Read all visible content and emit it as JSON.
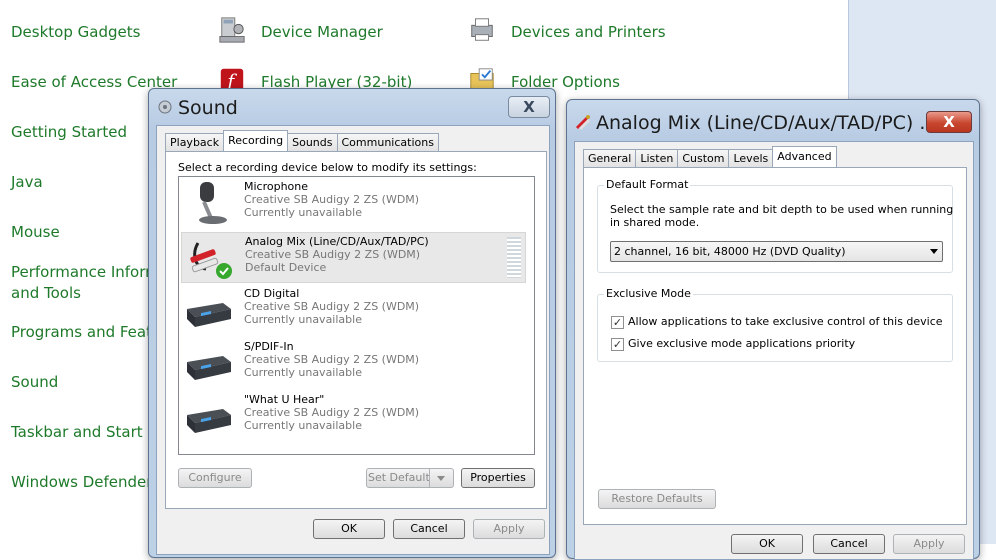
{
  "control_panel": {
    "left_links": [
      "Desktop Gadgets",
      "Ease of Access Center",
      "Getting Started",
      "Java",
      "Mouse",
      "Performance Inform",
      "and Tools",
      "Programs and Featu",
      "Sound",
      "Taskbar and Start M",
      "Windows Defender"
    ],
    "middle_links": [
      "Device Manager",
      "Flash Player (32-bit)"
    ],
    "right_links": [
      "Devices and Printers",
      "Folder Options"
    ]
  },
  "sound_dialog": {
    "title": "Sound",
    "tabs": [
      "Playback",
      "Recording",
      "Sounds",
      "Communications"
    ],
    "active_tab": "Recording",
    "instruction": "Select a recording device below to modify its settings:",
    "devices": [
      {
        "name": "Microphone",
        "driver": "Creative SB Audigy 2 ZS (WDM)",
        "status": "Currently unavailable"
      },
      {
        "name": "Analog Mix (Line/CD/Aux/TAD/PC)",
        "driver": "Creative SB Audigy 2 ZS (WDM)",
        "status": "Default Device"
      },
      {
        "name": "CD Digital",
        "driver": "Creative SB Audigy 2 ZS (WDM)",
        "status": "Currently unavailable"
      },
      {
        "name": "S/PDIF-In",
        "driver": "Creative SB Audigy 2 ZS (WDM)",
        "status": "Currently unavailable"
      },
      {
        "name": "\"What U Hear\"",
        "driver": "Creative SB Audigy 2 ZS (WDM)",
        "status": "Currently unavailable"
      }
    ],
    "configure_label": "Configure",
    "set_default_label": "Set Default",
    "properties_label": "Properties",
    "ok_label": "OK",
    "cancel_label": "Cancel",
    "apply_label": "Apply",
    "close_label": "X"
  },
  "props_dialog": {
    "title": "Analog Mix (Line/CD/Aux/TAD/PC) ...",
    "tabs": [
      "General",
      "Listen",
      "Custom",
      "Levels",
      "Advanced"
    ],
    "active_tab": "Advanced",
    "default_format_label": "Default Format",
    "default_format_desc_1": "Select the sample rate and bit depth to be used when running",
    "default_format_desc_2": "in shared mode.",
    "format_value": "2 channel, 16 bit, 48000 Hz (DVD Quality)",
    "exclusive_label": "Exclusive Mode",
    "exclusive_options": [
      {
        "label": "Allow applications to take exclusive control of this device",
        "checked": true
      },
      {
        "label": "Give exclusive mode applications priority",
        "checked": true
      }
    ],
    "restore_label": "Restore Defaults",
    "ok_label": "OK",
    "cancel_label": "Cancel",
    "apply_label": "Apply",
    "close_label": "X"
  }
}
